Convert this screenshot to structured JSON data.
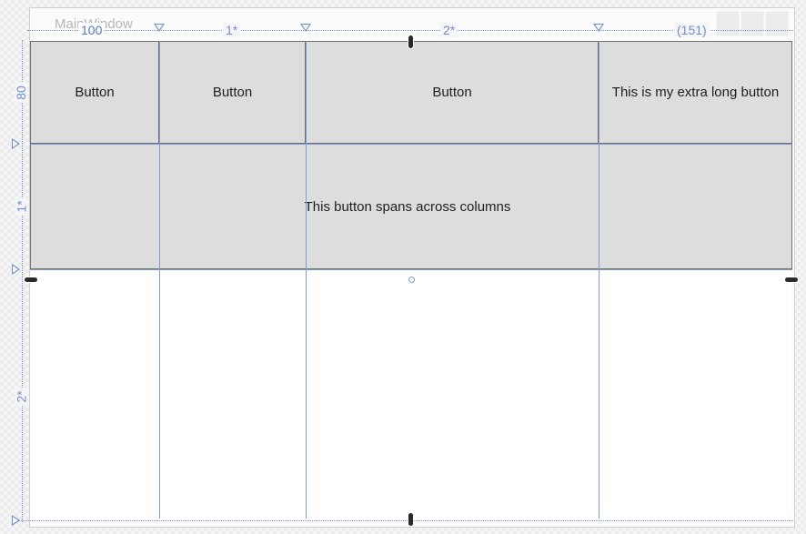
{
  "window": {
    "title": "MainWindow"
  },
  "column_definitions": [
    {
      "label": "100"
    },
    {
      "label": "1*"
    },
    {
      "label": "2*"
    },
    {
      "label": "(151)"
    }
  ],
  "row_definitions": [
    {
      "label": "80"
    },
    {
      "label": "1*"
    },
    {
      "label": "2*"
    }
  ],
  "buttons": {
    "button_1": "Button",
    "button_2": "Button",
    "button_3": "Button",
    "button_4": "This is my extra long button",
    "span_button": "This button spans across columns"
  },
  "colors": {
    "grid_line": "#7f9bd0",
    "button_face": "#dddddd",
    "button_border": "#707070"
  }
}
